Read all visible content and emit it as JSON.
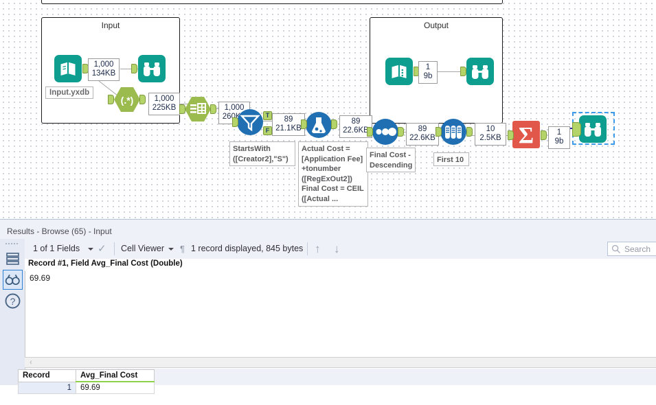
{
  "app": {
    "accent_blue": "#1f6fb2",
    "tool_teal": "#0e9e8f",
    "tool_green": "#9bbb4f",
    "tool_red": "#e1574a",
    "anchor_green": "#b4d369",
    "selection_blue": "#3d9ae8"
  },
  "canvas": {
    "containers": [
      {
        "name": "input-container",
        "title": "Input"
      },
      {
        "name": "output-container",
        "title": "Output"
      }
    ],
    "labels": {
      "input_file": "Input.yxdb"
    },
    "annotations": [
      {
        "name": "filter-annotation",
        "text": "StartsWith\n([Creator2],\"S\")"
      },
      {
        "name": "formula-annotation",
        "text": "Actual Cost =\n[Application Fee]\n+tonumber\n([RegExOut2])\nFinal Cost = CEIL\n([Actual ..."
      },
      {
        "name": "sort-annotation",
        "text": "Final Cost -\nDescending"
      },
      {
        "name": "sample-annotation",
        "text": "First 10"
      }
    ],
    "record_counts": [
      {
        "name": "rec-input-browse",
        "records": "1,000",
        "size": "134KB"
      },
      {
        "name": "rec-regex",
        "records": "1,000",
        "size": "225KB"
      },
      {
        "name": "rec-select",
        "records": "1,000",
        "size": "260KB"
      },
      {
        "name": "rec-filter-true",
        "records": "89",
        "size": "21.1KB"
      },
      {
        "name": "rec-formula",
        "records": "89",
        "size": "22.6KB"
      },
      {
        "name": "rec-sort",
        "records": "89",
        "size": "22.6KB"
      },
      {
        "name": "rec-sample",
        "records": "10",
        "size": "2.5KB"
      },
      {
        "name": "rec-summarize",
        "records": "1",
        "size": "9b"
      },
      {
        "name": "rec-output",
        "records": "1",
        "size": "9b"
      }
    ],
    "filter_outputs": {
      "true": "T",
      "false": "F"
    },
    "tools": [
      {
        "name": "input-data-tool",
        "icon": "book-icon"
      },
      {
        "name": "browse-input-tool",
        "icon": "binoculars-icon"
      },
      {
        "name": "regex-tool",
        "icon": "regex-icon"
      },
      {
        "name": "select-tool",
        "icon": "table-icon"
      },
      {
        "name": "filter-tool",
        "icon": "funnel-icon"
      },
      {
        "name": "formula-tool",
        "icon": "flask-icon"
      },
      {
        "name": "sort-tool",
        "icon": "dots-icon"
      },
      {
        "name": "sample-tool",
        "icon": "test-tubes-icon"
      },
      {
        "name": "summarize-tool",
        "icon": "sigma-icon"
      },
      {
        "name": "browse-final-tool",
        "icon": "binoculars-icon"
      },
      {
        "name": "output-data-tool",
        "icon": "book-icon"
      },
      {
        "name": "browse-output-tool",
        "icon": "binoculars-icon"
      }
    ]
  },
  "results": {
    "title": "Results - Browse (65) - Input",
    "toolbar": {
      "fields_label": "1 of 1 Fields",
      "view_label": "Cell Viewer",
      "status_label": "1 record displayed, 845 bytes",
      "up_arrow": "↑",
      "down_arrow": "↓",
      "pilcrow": "¶",
      "check": "✓"
    },
    "search": {
      "placeholder": "Search"
    },
    "cell_viewer": {
      "header": "Record #1, Field Avg_Final Cost (Double)",
      "value": "69.69",
      "scroll_arrow": "‹"
    },
    "grid": {
      "columns": [
        "Record",
        "Avg_Final Cost"
      ],
      "rows": [
        {
          "record": "1",
          "value": "69.69"
        }
      ]
    },
    "rail": [
      {
        "name": "rail-item-table",
        "icon": "layers-icon",
        "active": false
      },
      {
        "name": "rail-item-browse",
        "icon": "binoculars-icon",
        "active": true
      },
      {
        "name": "rail-item-help",
        "icon": "question-icon",
        "active": false
      }
    ]
  }
}
